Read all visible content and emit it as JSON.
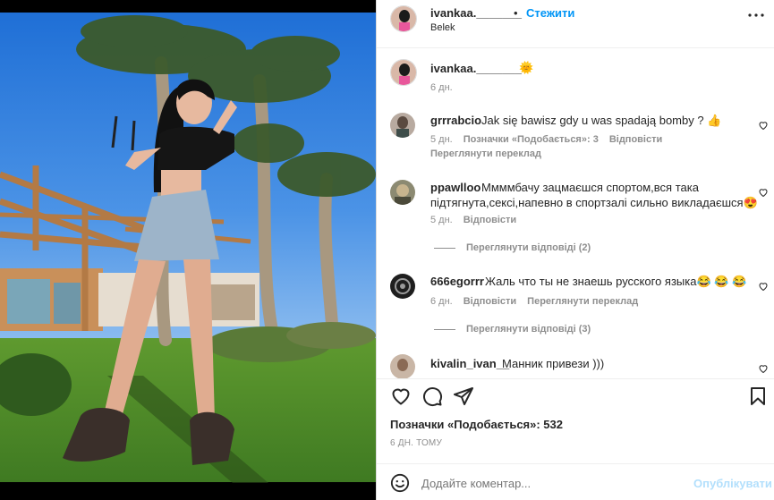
{
  "post": {
    "author": "ivankaa._______",
    "follow_label": "Стежити",
    "location": "Belek",
    "more_icon": "more-horizontal-icon"
  },
  "caption": {
    "author": "ivankaa._______",
    "emoji": "🌞",
    "time": "6 дн."
  },
  "comments": [
    {
      "author": "grrrabcio",
      "text": "Jak się bawisz gdy u was spadają bomby ? 👍",
      "time": "5 дн.",
      "likes": "Позначки «Подобається»: 3",
      "reply": "Відповісти",
      "translate": "Переглянути переклад"
    },
    {
      "author": "ppawlloo",
      "text_line1": "Ммммбачу зацмаєшся спортом,вся така",
      "text_line2": "підтягнута,сексі,напевно в спортзалі сильно викладаєшся😍",
      "time": "5 дн.",
      "reply": "Відповісти",
      "view_replies": "Переглянути відповіді (2)"
    },
    {
      "author": "666egorrr",
      "text": "Жаль что ты не знаешь русского языка😂 😂 😂",
      "time": "6 дн.",
      "reply": "Відповісти",
      "translate": "Переглянути переклад",
      "view_replies": "Переглянути відповіді (3)"
    },
    {
      "author": "kivalin_ivan__",
      "text": "Манник привези )))"
    }
  ],
  "actions": {
    "like_icon": "heart-icon",
    "comment_icon": "comment-icon",
    "share_icon": "share-icon",
    "save_icon": "bookmark-icon",
    "likes_text": "Позначки «Подобається»: 532",
    "timestamp": "6 ДН. ТОМУ"
  },
  "add_comment": {
    "emoji_icon": "emoji-icon",
    "placeholder": "Додайте коментар...",
    "publish_label": "Опублікувати"
  },
  "colors": {
    "accent": "#0095f6",
    "publish_disabled": "#b2dffc",
    "muted": "#8e8e8e",
    "text": "#262626"
  }
}
